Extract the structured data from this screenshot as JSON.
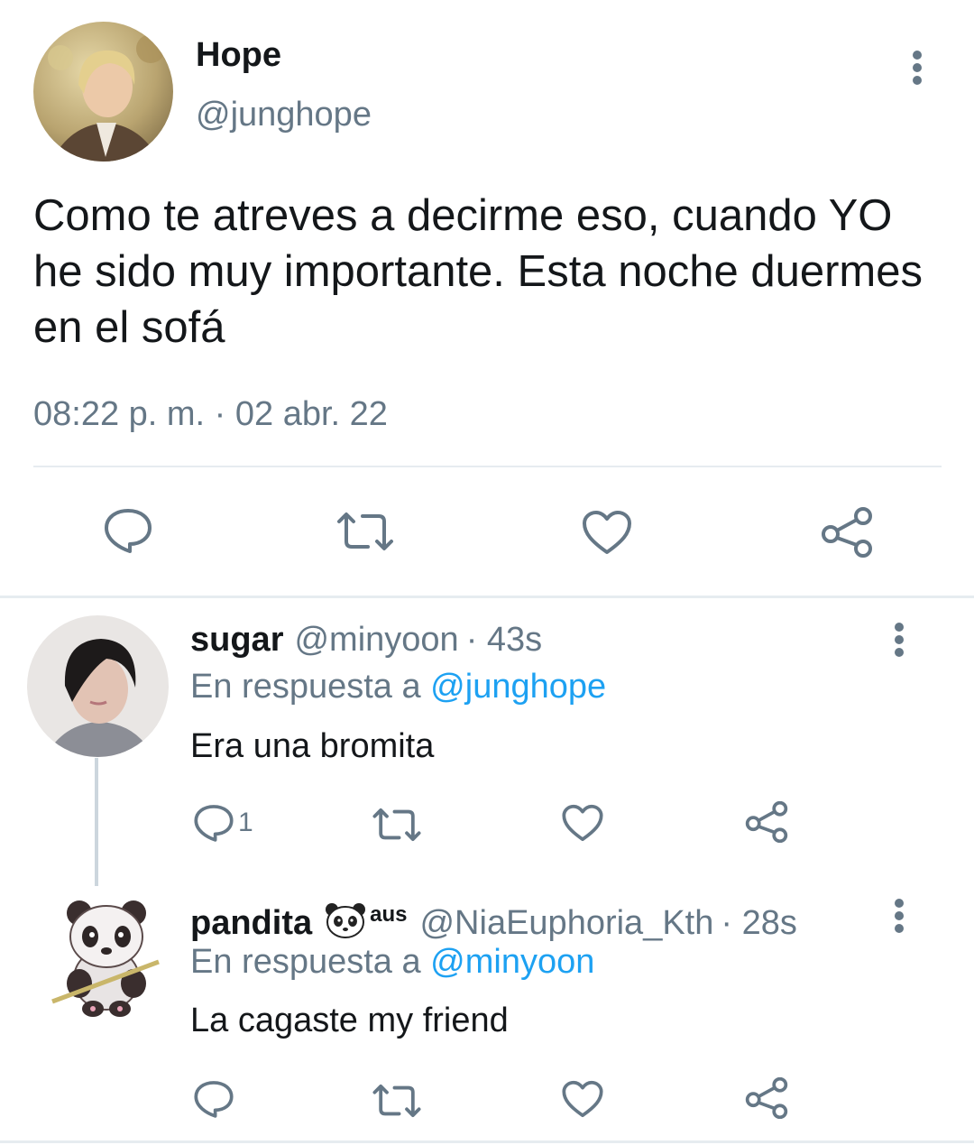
{
  "main_tweet": {
    "name": "Hope",
    "handle": "@junghope",
    "text": "Como te atreves a decirme eso, cuando YO he sido muy importante. Esta noche duermes en el sofá",
    "timestamp": "08:22 p. m. · 02 abr. 22",
    "actions": [
      "reply-icon",
      "retweet-icon",
      "like-icon",
      "share-icon"
    ]
  },
  "replies": [
    {
      "name": "sugar",
      "handle": "@minyoon",
      "time": "· 43s",
      "reply_prefix": "En respuesta a ",
      "reply_to": "@junghope",
      "text": "Era una bromita",
      "reply_count": "1"
    },
    {
      "name": "pandita",
      "badge_emoji": "panda-emoji-icon",
      "badge_text": "aus",
      "handle": "@NiaEuphoria_Kth",
      "time": "· 28s",
      "reply_prefix": "En respuesta a ",
      "reply_to": "@minyoon",
      "text": "La cagaste my friend",
      "reply_count": ""
    }
  ],
  "colors": {
    "text": "#14171a",
    "secondary": "#657786",
    "link": "#1da1f2",
    "divider": "#e6ecf0"
  }
}
